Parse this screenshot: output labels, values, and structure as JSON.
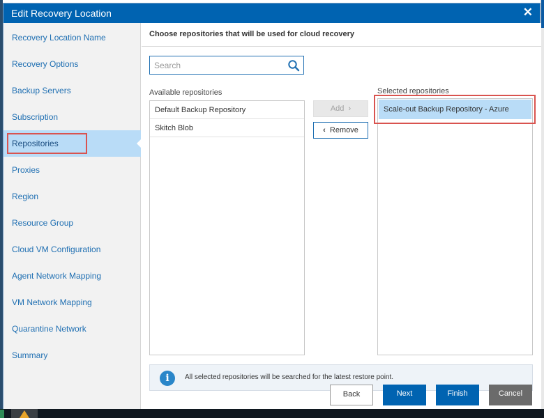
{
  "dialog": {
    "title": "Edit Recovery Location",
    "close_label": "✕"
  },
  "sidebar": {
    "items": [
      {
        "label": "Recovery Location Name"
      },
      {
        "label": "Recovery Options"
      },
      {
        "label": "Backup Servers"
      },
      {
        "label": "Subscription"
      },
      {
        "label": "Repositories",
        "active": true
      },
      {
        "label": "Proxies"
      },
      {
        "label": "Region"
      },
      {
        "label": "Resource Group"
      },
      {
        "label": "Cloud VM Configuration"
      },
      {
        "label": "Agent Network Mapping"
      },
      {
        "label": "VM Network Mapping"
      },
      {
        "label": "Quarantine Network"
      },
      {
        "label": "Summary"
      }
    ]
  },
  "main": {
    "heading": "Choose repositories that will be used for cloud recovery",
    "search": {
      "placeholder": "Search",
      "value": ""
    },
    "available": {
      "label": "Available repositories",
      "items": [
        "Default Backup Repository",
        "Skitch Blob"
      ]
    },
    "selected": {
      "label": "Selected repositories",
      "items": [
        "Scale-out Backup Repository - Azure"
      ]
    },
    "add_button": "Add",
    "remove_button": "Remove",
    "info_text": "All selected repositories will be searched for the latest restore point."
  },
  "footer": {
    "back": "Back",
    "next": "Next",
    "finish": "Finish",
    "cancel": "Cancel"
  },
  "colors": {
    "titlebar": "#0063b1",
    "nav_link": "#1f6fb2",
    "selection": "#b9dcf7",
    "highlight_box": "#d9534f"
  }
}
